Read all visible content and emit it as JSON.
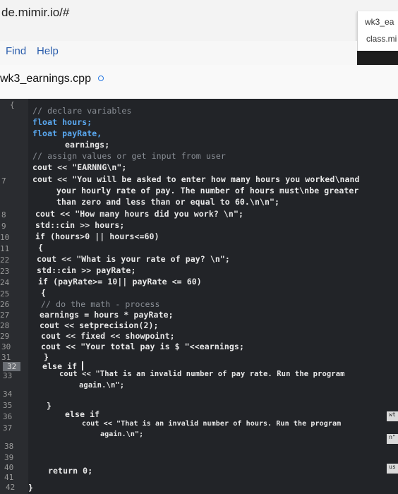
{
  "browser": {
    "url": "de.mimir.io/#",
    "side_tab_title": "wk3_ea",
    "side_tab_sub": "class.mi"
  },
  "menu": {
    "items": [
      "Find",
      "Help"
    ]
  },
  "editor": {
    "file_tab": "wk3_earnings.cpp",
    "line_numbers": [
      "{",
      "7",
      "8",
      "9",
      "10",
      "11",
      "22",
      "23",
      "24",
      "25",
      "26",
      "27",
      "28",
      "29",
      "30",
      "31",
      "32",
      "33",
      "34",
      "35",
      "36",
      "37",
      "38",
      "39",
      "40",
      "41",
      "42"
    ],
    "lines": [
      "// declare variables",
      "float hours;",
      "float payRate,",
      "earnings;",
      "// assign values or get input from user",
      "cout << \"EARNNG\\n\";",
      "cout << \"You will be asked to enter how many hours you worked\\nand",
      "your hourly rate of pay. The number of hours must\\nbe greater",
      "than zero and less than or equal to 60.\\n\\n\";",
      "cout << \"How many hours did you work? \\n\";",
      "std::cin >> hours;",
      "if (hours>0 || hours<=60)",
      "{",
      "cout << \"What is your rate of pay? \\n\";",
      "std::cin >> payRate;",
      "if (payRate>= 10|| payRate <= 60)",
      "{",
      "// do the math - process",
      "earnings = hours * payRate;",
      "cout << setprecision(2);",
      "cout << fixed << showpoint;",
      "cout << \"Your total pay is $ \"<<earnings;",
      "}",
      "else if",
      "cout << \"That is an invalid number of pay rate. Run the program",
      "again.\\n\";",
      "}",
      "else if",
      "cout << \"That is an invalid number of hours. Run the program",
      "again.\\n\";",
      "return 0;",
      "}"
    ],
    "edge_labels": [
      "wt",
      "n\"",
      "us"
    ]
  }
}
